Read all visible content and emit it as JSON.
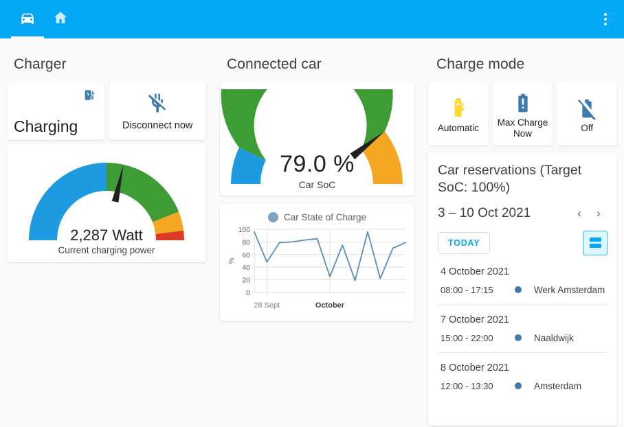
{
  "appbar": {
    "tabs": [
      {
        "name": "car-tab",
        "icon": "car-icon",
        "active": true
      },
      {
        "name": "home-tab",
        "icon": "home-icon",
        "active": false
      }
    ],
    "overflow_icon": "more-vert-icon"
  },
  "charger": {
    "title": "Charger",
    "status_label": "Charging",
    "status_icon": "ev-station-icon",
    "disconnect_label": "Disconnect now",
    "disconnect_icon": "plug-off-icon",
    "gauge": {
      "value_text": "2,287 Watt",
      "caption": "Current charging power",
      "value": 2287,
      "min": 0,
      "max": 4000,
      "needle_percent": 57,
      "bands": [
        {
          "from": 0,
          "to": 50,
          "color": "#1E9BE0"
        },
        {
          "from": 50,
          "to": 88,
          "color": "#3E9C35"
        },
        {
          "from": 88,
          "to": 96,
          "color": "#F5A623"
        },
        {
          "from": 96,
          "to": 100,
          "color": "#DB3B21"
        }
      ]
    }
  },
  "connected_car": {
    "title": "Connected car",
    "soc_gauge": {
      "value_text": "79.0 %",
      "caption": "Car SoC",
      "value": 79,
      "needle_percent": 79,
      "bands": [
        {
          "from": 0,
          "to": 14,
          "color": "#1E9BE0"
        },
        {
          "from": 14,
          "to": 79,
          "color": "#3E9C35"
        },
        {
          "from": 79,
          "to": 100,
          "color": "#F5A623"
        }
      ]
    },
    "chart_legend": "Car State of Charge"
  },
  "charge_mode": {
    "title": "Charge mode",
    "modes": [
      {
        "label": "Automatic",
        "icon": "battery-bolt-icon",
        "color": "#FDD835"
      },
      {
        "label": "Max Charge Now",
        "icon": "battery-alert-icon",
        "color": "#3d7ab0"
      },
      {
        "label": "Off",
        "icon": "battery-off-icon",
        "color": "#3d7ab0"
      }
    ]
  },
  "reservations": {
    "title": "Car reservations (Target SoC: 100%)",
    "range": "3 – 10 Oct 2021",
    "prev_icon": "chevron-left-icon",
    "next_icon": "chevron-right-icon",
    "today_label": "TODAY",
    "view_toggle_icon": "agenda-view-icon",
    "groups": [
      {
        "date": "4 October 2021",
        "items": [
          {
            "time": "08:00 - 17:15",
            "location": "Werk Amsterdam"
          }
        ]
      },
      {
        "date": "7 October 2021",
        "items": [
          {
            "time": "15:00 - 22:00",
            "location": "Naaldwijk"
          }
        ]
      },
      {
        "date": "8 October 2021",
        "items": [
          {
            "time": "12:00 - 13:30",
            "location": "Amsterdam"
          }
        ]
      }
    ]
  },
  "chart_data": {
    "type": "line",
    "title": "",
    "legend": [
      "Car State of Charge"
    ],
    "legend_position": "top",
    "xlabel": "",
    "ylabel": "%",
    "ylim": [
      0,
      100
    ],
    "yticks": [
      0,
      20,
      40,
      60,
      80,
      100
    ],
    "xticks": [
      "28 Sept",
      "October"
    ],
    "grid": true,
    "series": [
      {
        "name": "Car State of Charge",
        "color": "#5b8db8",
        "values": [
          96,
          48,
          79,
          80,
          83,
          85,
          25,
          75,
          19,
          96,
          22,
          70,
          79
        ]
      }
    ]
  }
}
